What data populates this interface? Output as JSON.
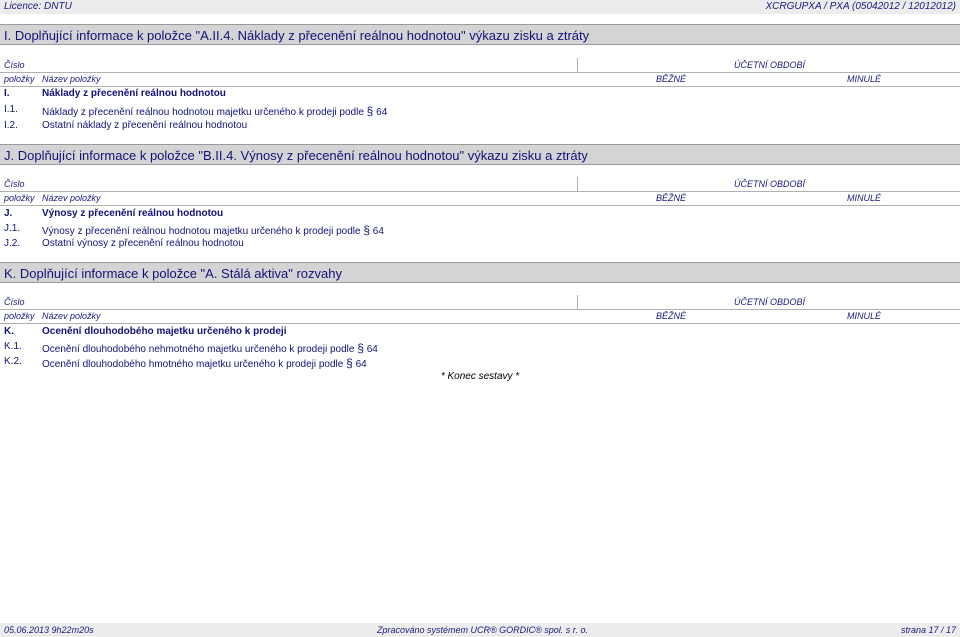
{
  "header": {
    "licence": "Licence: DNTU",
    "report": "XCRGUPXA / PXA (05042012 / 12012012)"
  },
  "columns": {
    "cislo": "Číslo",
    "polozky": "položky",
    "nazev": "Název položky",
    "ucetni": "ÚČETNÍ OBDOBÍ",
    "bezne": "BĚŽNÉ",
    "minule": "MINULÉ"
  },
  "sections": [
    {
      "title": "I. Doplňující informace k položce \"A.II.4. Náklady z přecenění reálnou hodnotou\" výkazu zisku a ztráty",
      "items": [
        {
          "code": "I.",
          "name": "Náklady z přecenění reálnou hodnotou"
        },
        {
          "code": "I.1.",
          "name": "Náklady z přecenění reálnou hodnotou majetku určeného k prodeji podle",
          "mark": "§",
          "num": "64"
        },
        {
          "code": "I.2.",
          "name": "Ostatní náklady z přecenění reálnou hodnotou"
        }
      ]
    },
    {
      "title": "J. Doplňující informace k položce \"B.II.4. Výnosy z přecenění reálnou hodnotou\" výkazu zisku a ztráty",
      "items": [
        {
          "code": "J.",
          "name": "Výnosy z přecenění reálnou hodnotou"
        },
        {
          "code": "J.1.",
          "name": "Výnosy z přecenění reálnou hodnotou majetku určeného k prodeji podle",
          "mark": "§",
          "num": "64"
        },
        {
          "code": "J.2.",
          "name": "Ostatní výnosy z přecenění reálnou hodnotou"
        }
      ]
    },
    {
      "title": "K. Doplňující informace k položce \"A. Stálá aktiva\" rozvahy",
      "items": [
        {
          "code": "K.",
          "name": "Ocenění dlouhodobého majetku určeného k prodeji"
        },
        {
          "code": "K.1.",
          "name": "Ocenění dlouhodobého nehmotného majetku určeného k prodeji podle",
          "mark": "§",
          "num": "64"
        },
        {
          "code": "K.2.",
          "name": "Ocenění dlouhodobého hmotného majetku určeného k prodeji podle",
          "mark": "§",
          "num": "64"
        }
      ]
    }
  ],
  "end_text": "* Konec sestavy *",
  "footer": {
    "date": "05.06.2013 9h22m20s",
    "processed": "Zpracováno systémem UCR® GORDIC® spol. s  r. o.",
    "page": "strana 17 / 17"
  }
}
